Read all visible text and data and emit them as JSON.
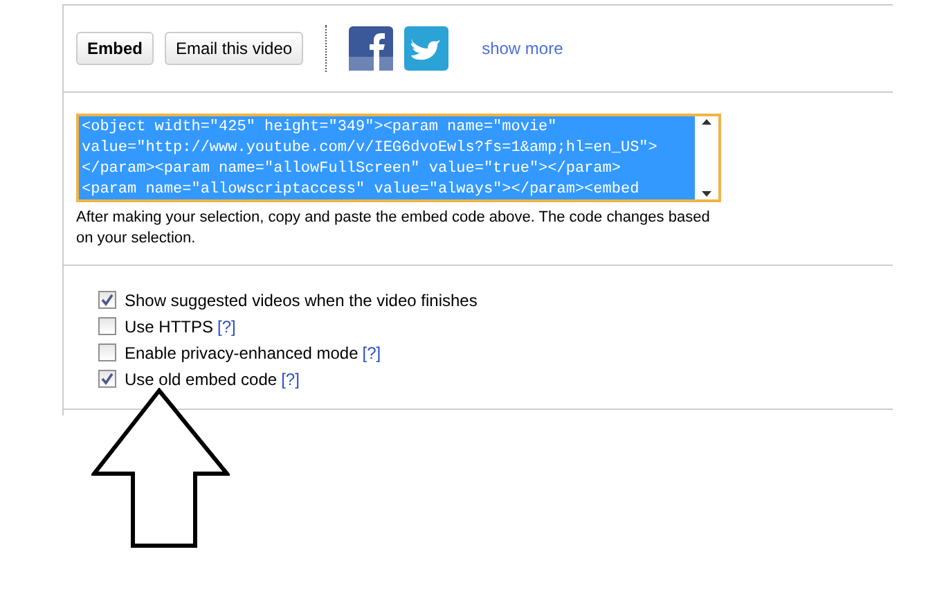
{
  "share_buttons": [
    {
      "label": "Embed",
      "selected": true
    },
    {
      "label": "Email this video",
      "selected": false
    }
  ],
  "social": {
    "show_more": "show more"
  },
  "embed_code": {
    "lines": [
      "<object width=\"425\" height=\"349\"><param name=\"movie\"",
      "value=\"http://www.youtube.com/v/IEG6dvoEwls?fs=1&amp;hl=en_US\">",
      "</param><param name=\"allowFullScreen\" value=\"true\"></param>",
      "<param name=\"allowscriptaccess\" value=\"always\"></param><embed"
    ]
  },
  "help_text": "After making your selection, copy and paste the embed code above. The code changes based on your selection.",
  "options": [
    {
      "label": "Show suggested videos when the video finishes",
      "checked": true
    },
    {
      "label": "Use HTTPS",
      "help": "[?]",
      "checked": false
    },
    {
      "label": "Enable privacy-enhanced mode",
      "help": "[?]",
      "checked": false
    },
    {
      "label": "Use old embed code",
      "help": "[?]",
      "checked": true
    }
  ]
}
